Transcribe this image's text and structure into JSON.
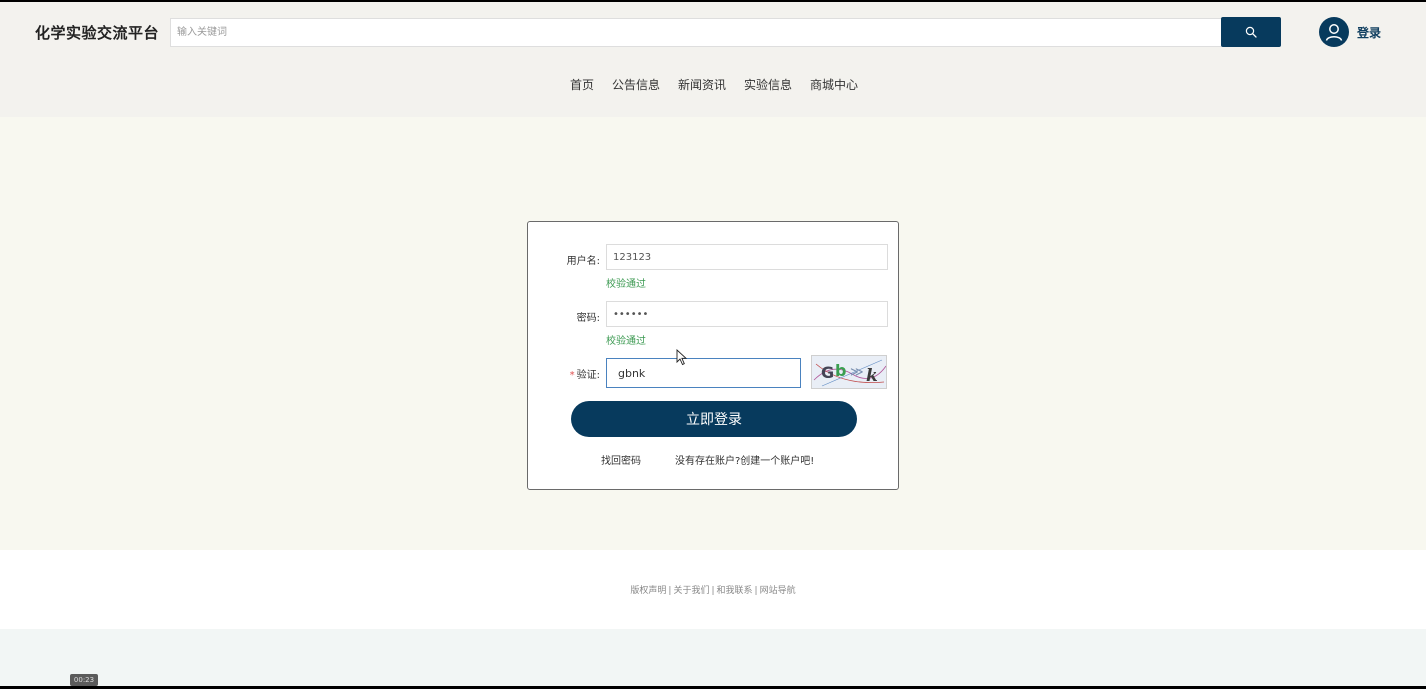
{
  "header": {
    "brand": "化学实验交流平台",
    "search_placeholder": "输入关键词",
    "login_label": "登录",
    "nav": [
      "首页",
      "公告信息",
      "新闻资讯",
      "实验信息",
      "商城中心"
    ]
  },
  "login_form": {
    "username_label": "用户名:",
    "username_value": "123123",
    "username_status": "校验通过",
    "password_label": "密码:",
    "password_value": "••••••",
    "password_status": "校验通过",
    "captcha_required_mark": "*",
    "captcha_label": "验证:",
    "captcha_value": "gbnk",
    "captcha_image_text": "Gb k",
    "submit_label": "立即登录",
    "forgot_password": "找回密码",
    "register_prompt": "没有存在账户?创建一个账户吧!"
  },
  "footer": {
    "links": [
      "版权声明",
      "关于我们",
      "和我联系",
      "网站导航"
    ]
  },
  "overlay": {
    "timestamp": "00:23"
  },
  "colors": {
    "primary": "#073a5d",
    "success": "#3c9a52",
    "header_bg": "#f3f2ee",
    "main_bg": "#f8f8f0"
  }
}
